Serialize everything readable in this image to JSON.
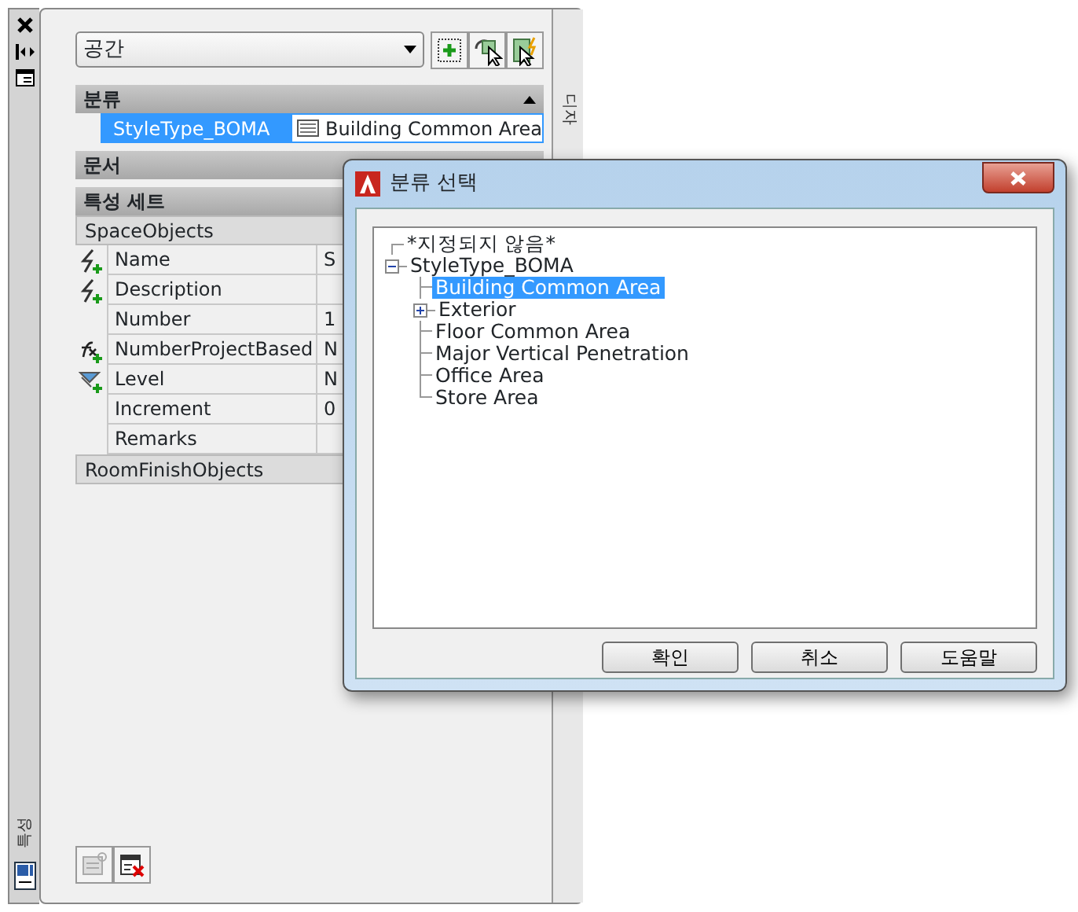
{
  "side_strip": {
    "tab_label": "특성"
  },
  "right_strip": {
    "tab_label": "디자"
  },
  "palette": {
    "style_dropdown": {
      "value": "공간"
    },
    "sections": [
      {
        "kind": "category",
        "title": "분류",
        "expanded": true,
        "rows": [
          {
            "label": "StyleType_BOMA",
            "value": "Building Common Area",
            "selected": true
          }
        ]
      },
      {
        "title": "문서",
        "expanded": false
      },
      {
        "kind": "propsets",
        "title": "특성 세트",
        "expanded": true,
        "groups": [
          {
            "name": "SpaceObjects",
            "rows": [
              {
                "kind": "auto",
                "label": "Name",
                "value": "S"
              },
              {
                "kind": "auto",
                "label": "Description"
              },
              {
                "kind": "plain",
                "label": "Number",
                "value": "1"
              },
              {
                "kind": "formula",
                "label": "NumberProjectBased",
                "value": "N"
              },
              {
                "kind": "location",
                "label": "Level",
                "value": "N"
              },
              {
                "kind": "plain",
                "label": "Increment",
                "value": "0"
              },
              {
                "kind": "plain",
                "label": "Remarks"
              }
            ]
          },
          {
            "name": "RoomFinishObjects"
          }
        ]
      }
    ]
  },
  "dialog": {
    "title": "분류 선택",
    "tree": [
      {
        "label": "*지정되지 않음*",
        "selected": false
      },
      {
        "label": "StyleType_BOMA",
        "selected": false,
        "expanded": true,
        "children": [
          {
            "label": "Building Common Area",
            "selected": true
          },
          {
            "label": "Exterior",
            "selected": false,
            "expanded": false,
            "has_children": true
          },
          {
            "label": "Floor Common Area",
            "selected": false
          },
          {
            "label": "Major Vertical Penetration",
            "selected": false
          },
          {
            "label": "Office Area",
            "selected": false
          },
          {
            "label": "Store Area",
            "selected": false
          }
        ]
      }
    ],
    "buttons": [
      "확인",
      "취소",
      "도움말"
    ]
  }
}
